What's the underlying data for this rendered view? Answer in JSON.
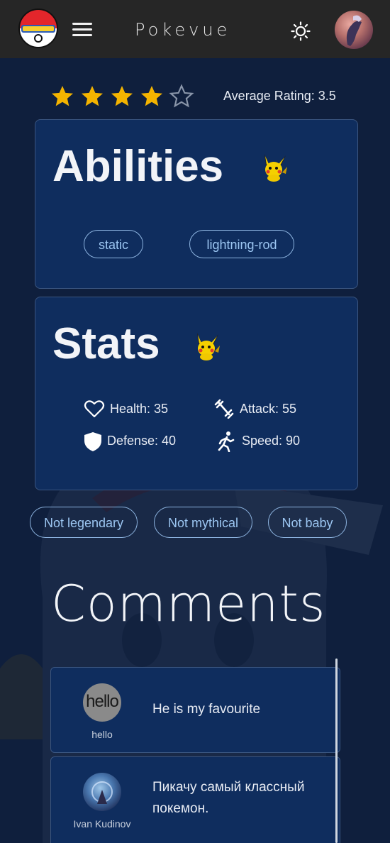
{
  "header": {
    "title": "Pokevue",
    "logo_text": "Pokémon"
  },
  "rating": {
    "stars": 4,
    "max": 5,
    "average_label": "Average Rating: 3.5"
  },
  "abilities": {
    "title": "Abilities",
    "items": [
      "static",
      "lightning-rod"
    ]
  },
  "stats": {
    "title": "Stats",
    "health": "Health: 35",
    "attack": "Attack: 55",
    "defense": "Defense: 40",
    "speed": "Speed: 90"
  },
  "tags": [
    "Not legendary",
    "Not mythical",
    "Not baby"
  ],
  "comments": {
    "title": "Comments",
    "items": [
      {
        "avatar_text": "hello",
        "author": "hello",
        "text": "He is my favourite"
      },
      {
        "avatar_text": "",
        "author": "Ivan Kudinov",
        "text": "Пикачу самый классный покемон."
      }
    ]
  },
  "colors": {
    "background": "#0f1f3d",
    "card": "#0f2d5e",
    "header": "#262626",
    "star": "#f4b400",
    "chip_text": "#9cc6f2"
  }
}
